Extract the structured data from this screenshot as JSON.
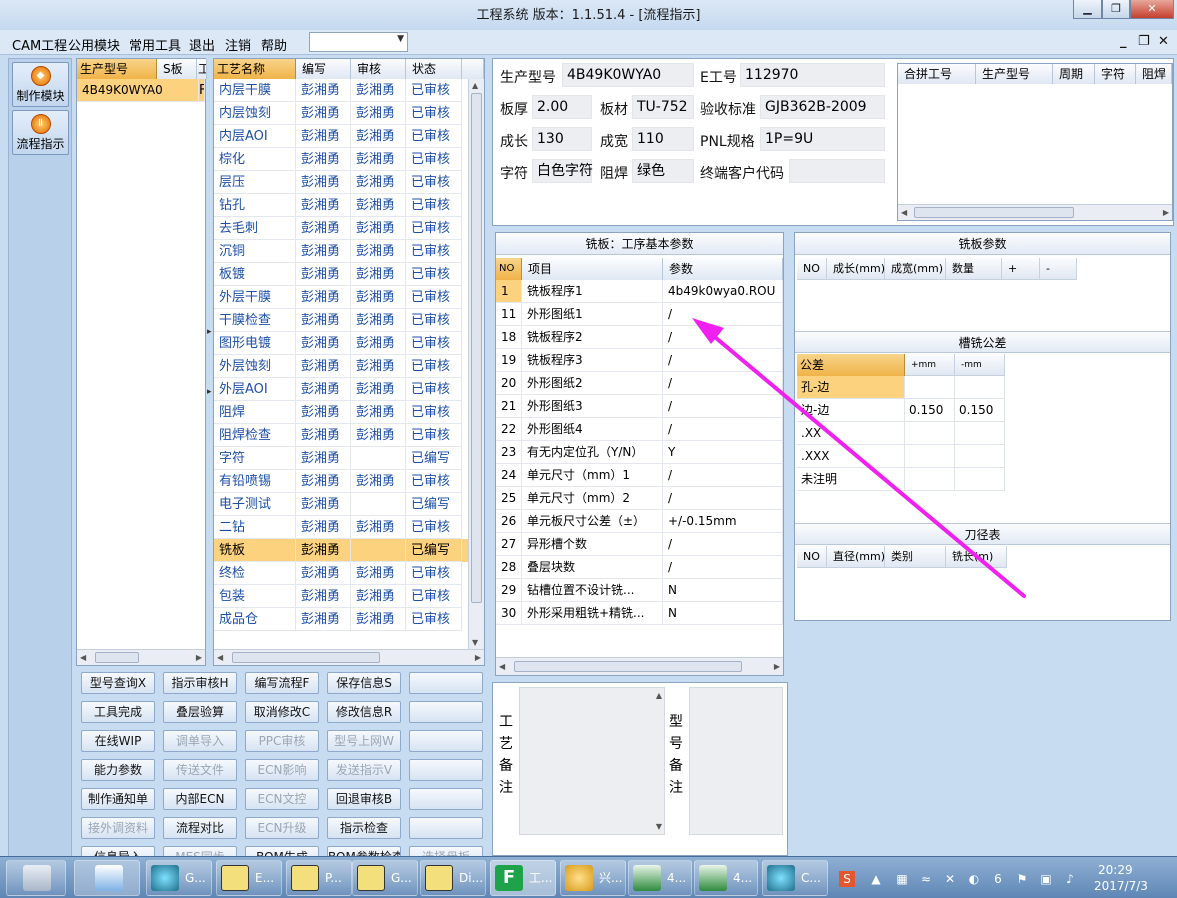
{
  "window": {
    "title": "工程系统  版本：1.1.51.4 - [流程指示]"
  },
  "menu": {
    "items": [
      "CAM工程",
      "公用模块",
      "常用工具",
      "退出",
      "注销",
      "帮助"
    ]
  },
  "nav": {
    "items": [
      {
        "label": "制作模块",
        "icon": "make-module-icon"
      },
      {
        "label": "流程指示",
        "icon": "flow-icon"
      }
    ]
  },
  "product_list": {
    "headers": [
      "生产型号",
      "S板",
      "工"
    ],
    "rows": [
      {
        "model": "4B49K0WYA0",
        "s": "",
        "extra": "F"
      }
    ]
  },
  "process_table": {
    "headers": [
      "工艺名称",
      "编写",
      "审核",
      "状态"
    ],
    "rows": [
      {
        "name": "内层干膜",
        "writer": "彭湘勇",
        "reviewer": "彭湘勇",
        "status": "已审核"
      },
      {
        "name": "内层蚀刻",
        "writer": "彭湘勇",
        "reviewer": "彭湘勇",
        "status": "已审核"
      },
      {
        "name": "内层AOI",
        "writer": "彭湘勇",
        "reviewer": "彭湘勇",
        "status": "已审核"
      },
      {
        "name": "棕化",
        "writer": "彭湘勇",
        "reviewer": "彭湘勇",
        "status": "已审核"
      },
      {
        "name": "层压",
        "writer": "彭湘勇",
        "reviewer": "彭湘勇",
        "status": "已审核"
      },
      {
        "name": "钻孔",
        "writer": "彭湘勇",
        "reviewer": "彭湘勇",
        "status": "已审核"
      },
      {
        "name": "去毛刺",
        "writer": "彭湘勇",
        "reviewer": "彭湘勇",
        "status": "已审核"
      },
      {
        "name": "沉铜",
        "writer": "彭湘勇",
        "reviewer": "彭湘勇",
        "status": "已审核"
      },
      {
        "name": "板镀",
        "writer": "彭湘勇",
        "reviewer": "彭湘勇",
        "status": "已审核"
      },
      {
        "name": "外层干膜",
        "writer": "彭湘勇",
        "reviewer": "彭湘勇",
        "status": "已审核"
      },
      {
        "name": "干膜检查",
        "writer": "彭湘勇",
        "reviewer": "彭湘勇",
        "status": "已审核"
      },
      {
        "name": "图形电镀",
        "writer": "彭湘勇",
        "reviewer": "彭湘勇",
        "status": "已审核"
      },
      {
        "name": "外层蚀刻",
        "writer": "彭湘勇",
        "reviewer": "彭湘勇",
        "status": "已审核"
      },
      {
        "name": "外层AOI",
        "writer": "彭湘勇",
        "reviewer": "彭湘勇",
        "status": "已审核"
      },
      {
        "name": "阻焊",
        "writer": "彭湘勇",
        "reviewer": "彭湘勇",
        "status": "已审核"
      },
      {
        "name": "阻焊检查",
        "writer": "彭湘勇",
        "reviewer": "彭湘勇",
        "status": "已审核"
      },
      {
        "name": "字符",
        "writer": "彭湘勇",
        "reviewer": "",
        "status": "已编写"
      },
      {
        "name": "有铅喷锡",
        "writer": "彭湘勇",
        "reviewer": "彭湘勇",
        "status": "已审核"
      },
      {
        "name": "电子测试",
        "writer": "彭湘勇",
        "reviewer": "",
        "status": "已编写"
      },
      {
        "name": "二钻",
        "writer": "彭湘勇",
        "reviewer": "彭湘勇",
        "status": "已审核"
      },
      {
        "name": "铣板",
        "writer": "彭湘勇",
        "reviewer": "",
        "status": "已编写"
      },
      {
        "name": "终检",
        "writer": "彭湘勇",
        "reviewer": "彭湘勇",
        "status": "已审核"
      },
      {
        "name": "包装",
        "writer": "彭湘勇",
        "reviewer": "彭湘勇",
        "status": "已审核"
      },
      {
        "name": "成品仓",
        "writer": "彭湘勇",
        "reviewer": "彭湘勇",
        "status": "已审核"
      }
    ]
  },
  "buttons": [
    {
      "label": "型号查询X",
      "enabled": true
    },
    {
      "label": "指示审核H",
      "enabled": true
    },
    {
      "label": "编写流程F",
      "enabled": true
    },
    {
      "label": "保存信息S",
      "enabled": true
    },
    {
      "label": "",
      "enabled": true
    },
    {
      "label": "工具完成",
      "enabled": true
    },
    {
      "label": "叠层验算",
      "enabled": true
    },
    {
      "label": "取消修改C",
      "enabled": true
    },
    {
      "label": "修改信息R",
      "enabled": true
    },
    {
      "label": "",
      "enabled": true
    },
    {
      "label": "在线WIP",
      "enabled": true
    },
    {
      "label": "调单导入",
      "enabled": false
    },
    {
      "label": "PPC审核",
      "enabled": false
    },
    {
      "label": "型号上网W",
      "enabled": false
    },
    {
      "label": "",
      "enabled": true
    },
    {
      "label": "能力参数",
      "enabled": true
    },
    {
      "label": "传送文件",
      "enabled": false
    },
    {
      "label": "ECN影响",
      "enabled": false
    },
    {
      "label": "发送指示V",
      "enabled": false
    },
    {
      "label": "",
      "enabled": true
    },
    {
      "label": "制作通知单",
      "enabled": true
    },
    {
      "label": "内部ECN",
      "enabled": true
    },
    {
      "label": "ECN文控",
      "enabled": false
    },
    {
      "label": "回退审核B",
      "enabled": true
    },
    {
      "label": "",
      "enabled": true
    },
    {
      "label": "接外调资料",
      "enabled": false
    },
    {
      "label": "流程对比",
      "enabled": true
    },
    {
      "label": "ECN升级",
      "enabled": false
    },
    {
      "label": "指示检查",
      "enabled": true
    },
    {
      "label": "",
      "enabled": true
    },
    {
      "label": "信息导入",
      "enabled": true
    },
    {
      "label": "MES同步",
      "enabled": false
    },
    {
      "label": "BOM生成",
      "enabled": true
    },
    {
      "label": "BOM参数检查",
      "enabled": true
    },
    {
      "label": "选择母板",
      "enabled": false
    }
  ],
  "info": {
    "model_label": "生产型号",
    "model": "4B49K0WYA0",
    "eno_label": "E工号",
    "eno": "112970",
    "thickness_label": "板厚",
    "thickness": "2.00",
    "material_label": "板材",
    "material": "TU-752",
    "standard_label": "验收标准",
    "standard": "GJB362B-2009",
    "length_label": "成长",
    "length": "130",
    "width_label": "成宽",
    "width": "110",
    "pnl_label": "PNL规格",
    "pnl": "1P=9U",
    "char_label": "字符",
    "char": "白色字符",
    "mask_label": "阻焊",
    "mask": "绿色",
    "customer_label": "终端客户代码",
    "customer": ""
  },
  "merge_table": {
    "headers": [
      "合拼工号",
      "生产型号",
      "周期",
      "字符",
      "阻焊"
    ]
  },
  "params": {
    "title": "铣板：工序基本参数",
    "headers": [
      "NO",
      "项目",
      "参数"
    ],
    "rows": [
      {
        "no": "1",
        "item": "铣板程序1",
        "value": "4b49k0wya0.ROU"
      },
      {
        "no": "11",
        "item": "外形图纸1",
        "value": "/"
      },
      {
        "no": "18",
        "item": "铣板程序2",
        "value": "/"
      },
      {
        "no": "19",
        "item": "铣板程序3",
        "value": "/"
      },
      {
        "no": "20",
        "item": "外形图纸2",
        "value": "/"
      },
      {
        "no": "21",
        "item": "外形图纸3",
        "value": "/"
      },
      {
        "no": "22",
        "item": "外形图纸4",
        "value": "/"
      },
      {
        "no": "23",
        "item": "有无内定位孔（Y/N）",
        "value": "Y"
      },
      {
        "no": "24",
        "item": "单元尺寸（mm）1",
        "value": "/"
      },
      {
        "no": "25",
        "item": "单元尺寸（mm）2",
        "value": "/"
      },
      {
        "no": "26",
        "item": "单元板尺寸公差（±）",
        "value": "+/-0.15mm"
      },
      {
        "no": "27",
        "item": "异形槽个数",
        "value": "/"
      },
      {
        "no": "28",
        "item": "叠层块数",
        "value": "/"
      },
      {
        "no": "29",
        "item": "钻槽位置不设计铣...",
        "value": "N"
      },
      {
        "no": "30",
        "item": "外形采用粗铣+精铣...",
        "value": "N"
      }
    ]
  },
  "mill_params": {
    "title": "铣板参数",
    "headers": [
      "NO",
      "成长(mm)",
      "成宽(mm)",
      "数量",
      "+",
      "-"
    ]
  },
  "slot_tol": {
    "title": "槽铣公差",
    "headers": [
      "公差",
      "+mm",
      "-mm"
    ],
    "rows": [
      {
        "name": "孔-边",
        "plus": "",
        "minus": ""
      },
      {
        "name": "边-边",
        "plus": "0.150",
        "minus": "0.150"
      },
      {
        "name": ".XX",
        "plus": "",
        "minus": ""
      },
      {
        "name": ".XXX",
        "plus": "",
        "minus": ""
      },
      {
        "name": "未注明",
        "plus": "",
        "minus": ""
      }
    ]
  },
  "tool_table": {
    "title": "刀径表",
    "headers": [
      "NO",
      "直径(mm)",
      "类别",
      "铣长(m)"
    ]
  },
  "notes": {
    "process_label": "工艺备注",
    "model_label": "型号备注"
  },
  "taskbar": {
    "items": [
      "",
      "",
      "G...",
      "E...",
      "P...",
      "G...",
      "Di...",
      "工...",
      "兴...",
      "4...",
      "4...",
      "C..."
    ],
    "time": "20:29",
    "date": "2017/7/3"
  },
  "colors": {
    "selected_row": "#fdd27e",
    "header": "#f5c060",
    "arrow": "#f020f0",
    "link_text": "#1d4fa8"
  }
}
